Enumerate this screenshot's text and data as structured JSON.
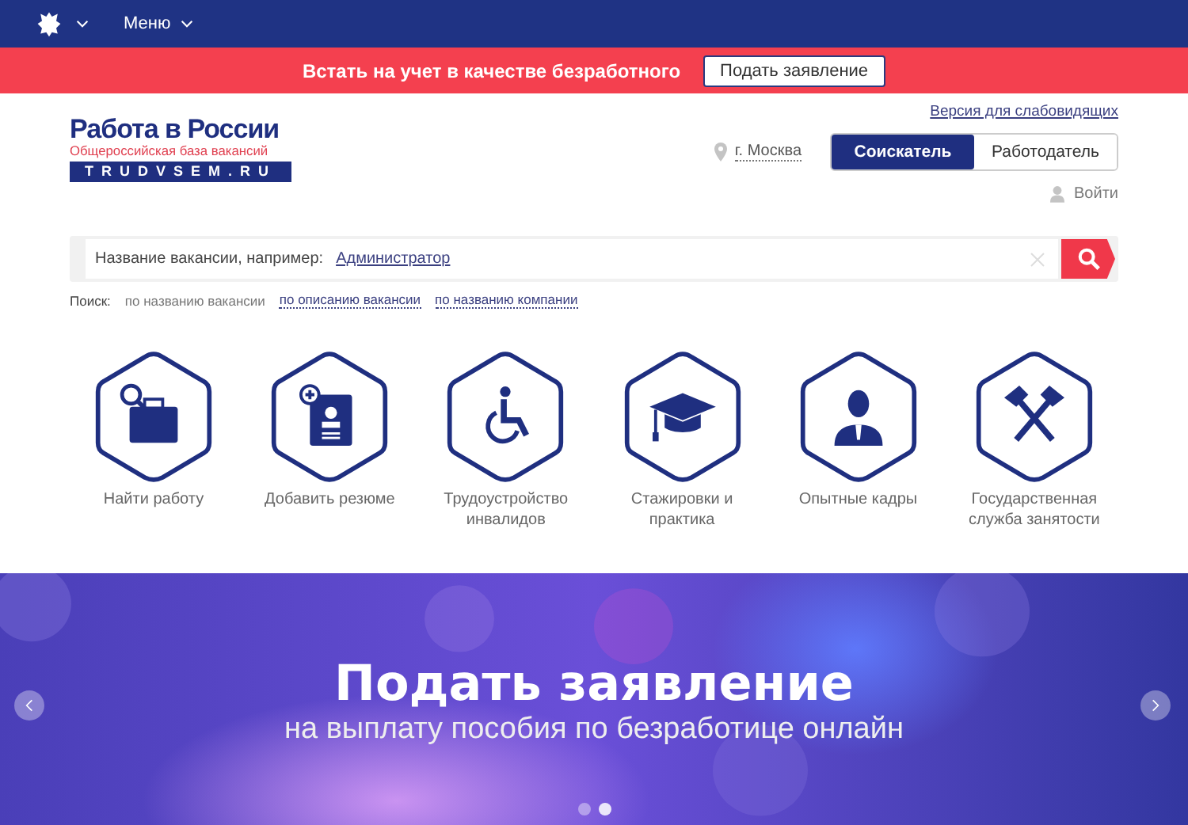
{
  "top_bar": {
    "menu_label": "Меню"
  },
  "promo_bar": {
    "text": "Встать на учет в качестве безработного",
    "button": "Подать заявление"
  },
  "logo": {
    "title": "Работа в России",
    "subtitle": "Общероссийская база вакансий",
    "domain": "TRUDVSEM.RU"
  },
  "accessibility_link": "Версия для слабовидящих",
  "city": "г. Москва",
  "roles": [
    {
      "label": "Соискатель",
      "selected": true
    },
    {
      "label": "Работодатель",
      "selected": false
    }
  ],
  "login": "Войти",
  "search": {
    "hint": "Название вакансии, например:",
    "example": "Администратор"
  },
  "search_modes": {
    "label": "Поиск:",
    "options": [
      {
        "label": "по названию вакансии",
        "selected": true
      },
      {
        "label": "по описанию вакансии",
        "selected": false
      },
      {
        "label": "по названию компании",
        "selected": false
      }
    ]
  },
  "categories": [
    {
      "kind": "briefcase",
      "label": "Найти работу"
    },
    {
      "kind": "resume",
      "label": "Добавить резюме"
    },
    {
      "kind": "wheelchair",
      "label": "Трудоустройство инвалидов"
    },
    {
      "kind": "cap",
      "label": "Стажировки и практика"
    },
    {
      "kind": "person",
      "label": "Опытные кадры"
    },
    {
      "kind": "hammers",
      "label": "Государственная служба занятости"
    }
  ],
  "banner": {
    "title": "Подать заявление",
    "subtitle": "на выплату пособия по безработице онлайн",
    "slides": [
      {
        "selected": false
      },
      {
        "selected": true
      }
    ]
  }
}
